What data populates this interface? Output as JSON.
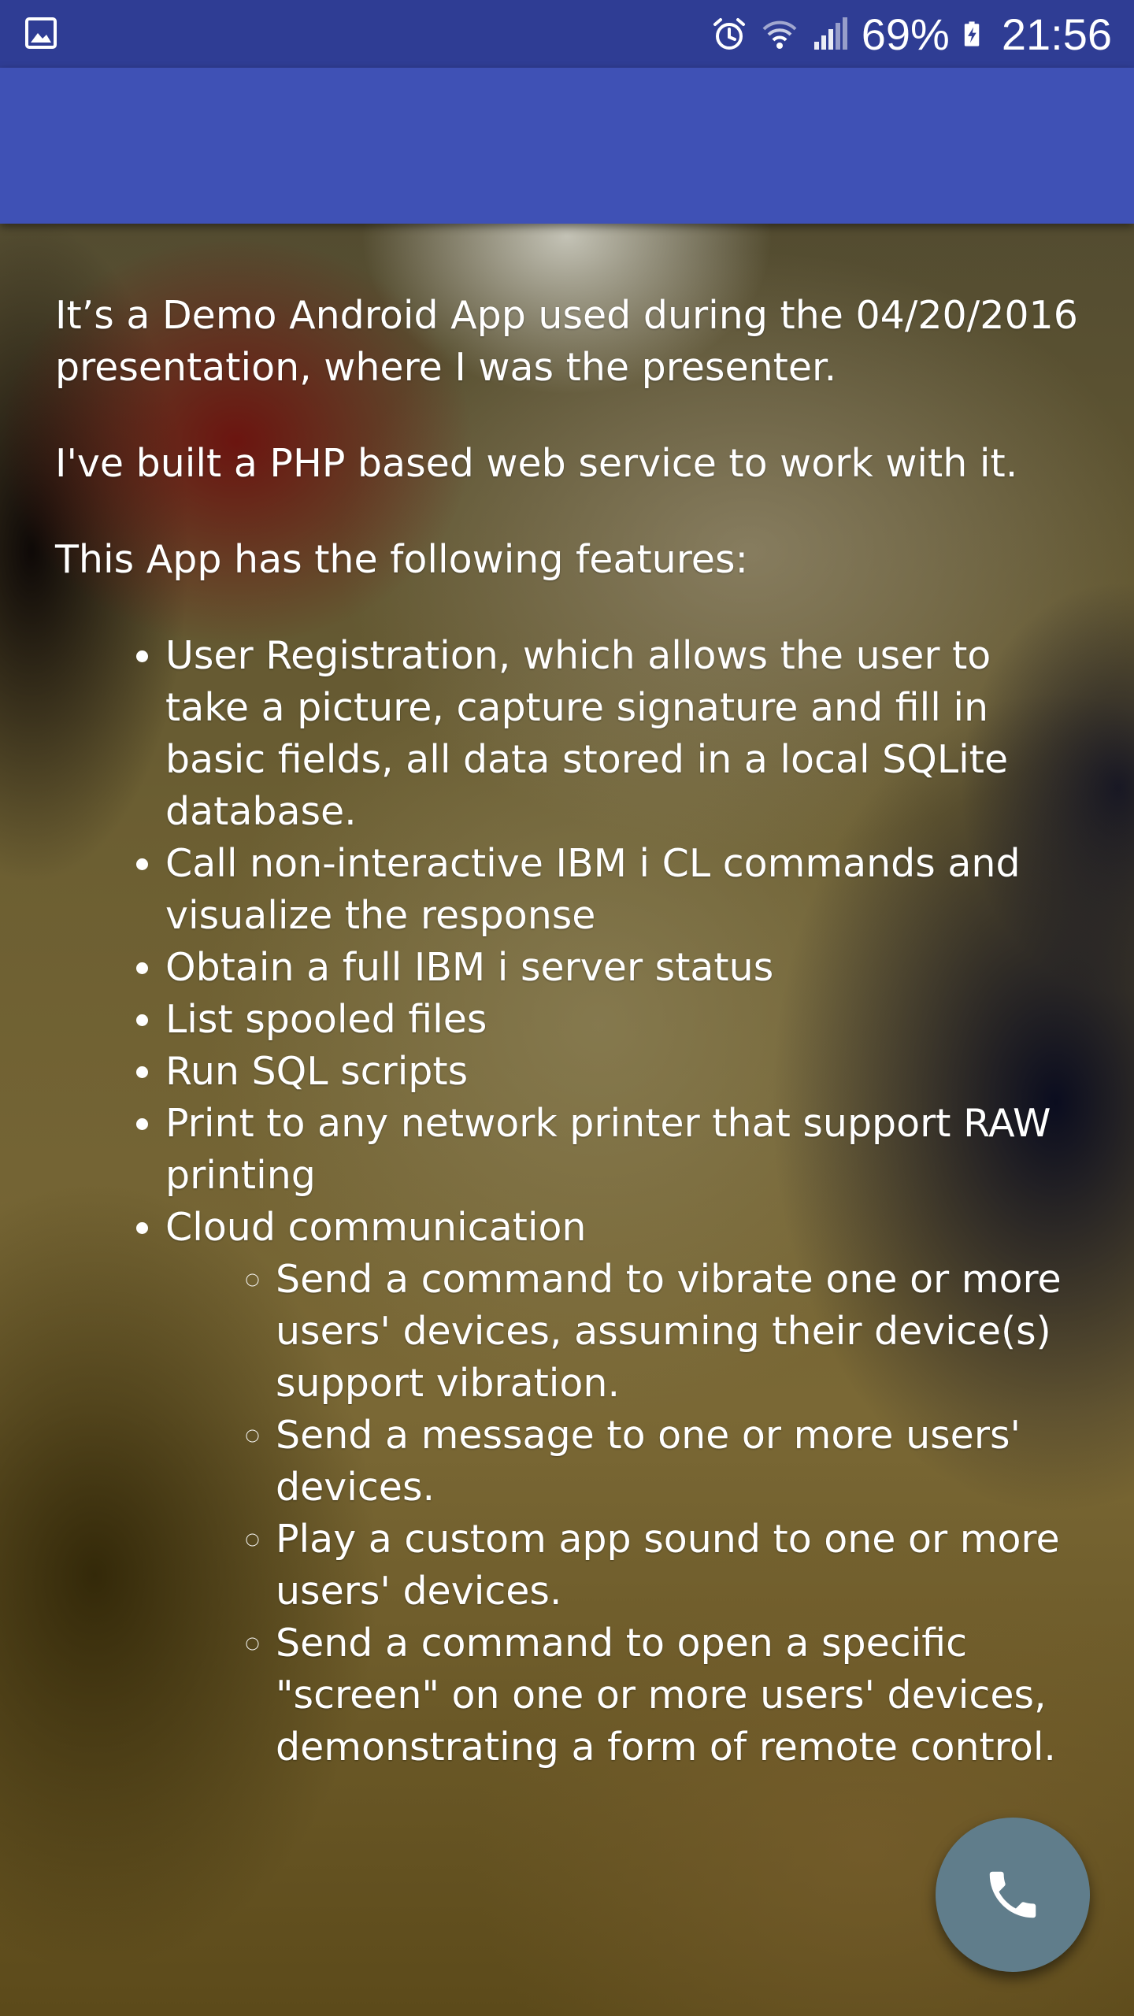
{
  "status_bar": {
    "battery": "69%",
    "time": "21:56",
    "icons": [
      "gallery-notification-icon",
      "alarm-icon",
      "wifi-icon",
      "signal-icon",
      "battery-charging-icon"
    ]
  },
  "app_bar": {
    "title": ""
  },
  "content": {
    "intro": "It’s a Demo Android App used during the 04/20/2016 presentation, where I was the presenter.",
    "web_service": "I've built a PHP based web service to work with it.",
    "features_heading": "This App has the following features:",
    "features": [
      "User Registration, which allows the user to take a picture, capture signature and fill in basic fields, all data stored in a local SQLite database.",
      "Call non-interactive IBM i CL commands and visualize the response",
      "Obtain a full IBM i server status",
      "List spooled files",
      "Run SQL scripts",
      "Print to any network printer that support RAW printing",
      "Cloud communication"
    ],
    "cloud_features": [
      "Send a command to vibrate one or more users' devices, assuming their device(s) support vibration.",
      "Send a message to one or more users' devices.",
      "Play a custom app sound to one or more users' devices.",
      "Send a command to open a specific \"screen\" on one or more users' devices, demonstrating a form of remote control."
    ]
  },
  "fab": {
    "icon": "phone-icon",
    "color": "#607d8b"
  },
  "colors": {
    "status_bar": "#2f3d94",
    "app_bar": "#3f51b5"
  }
}
